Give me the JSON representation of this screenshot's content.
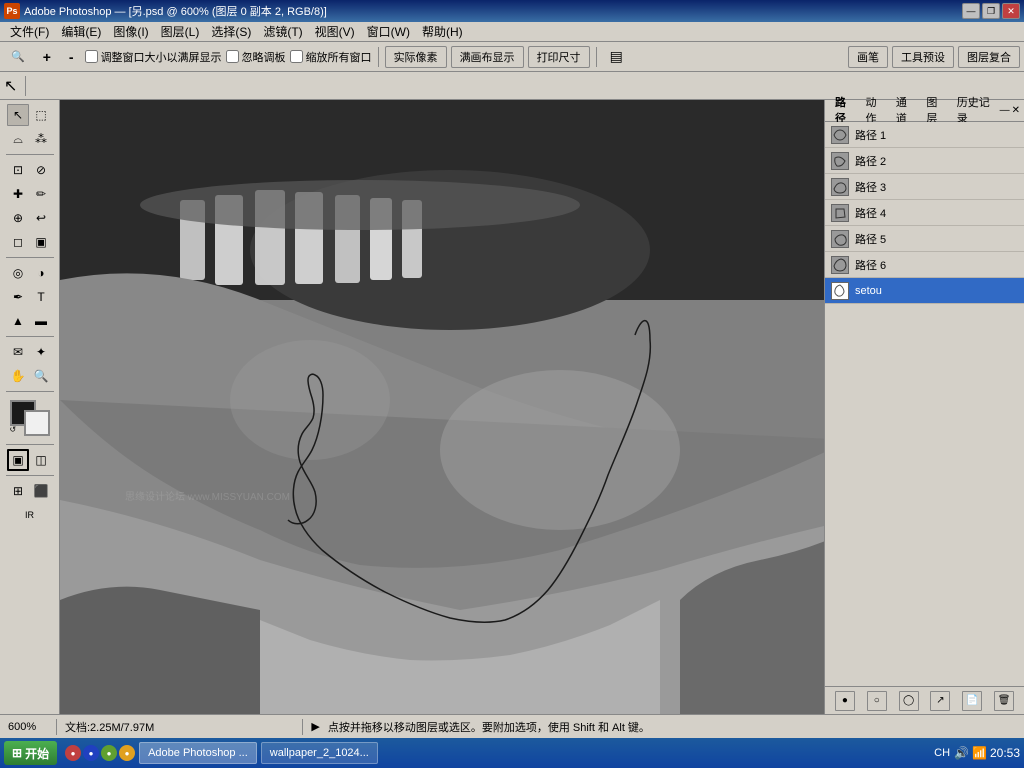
{
  "titlebar": {
    "title": "Adobe Photoshop — [另.psd @ 600% (图层 0 副本 2, RGB/8)]",
    "icon_label": "PS",
    "min_btn": "—",
    "restore_btn": "❐",
    "close_btn": "✕"
  },
  "menubar": {
    "items": [
      "文件(F)",
      "编辑(E)",
      "图像(I)",
      "图层(L)",
      "选择(S)",
      "滤镜(T)",
      "视图(V)",
      "窗口(W)",
      "帮助(H)"
    ]
  },
  "toolbar": {
    "zoom_in": "+",
    "zoom_out": "-",
    "fit_window_label": "调整窗口大小以满屏显示",
    "ignore_panel_label": "忽略调板",
    "shrink_all_label": "缩放所有窗口",
    "actual_pixels_label": "实际像素",
    "fill_screen_label": "满画布显示",
    "print_size_label": "打印尺寸"
  },
  "options_bar": {
    "tool_icon": "⊕"
  },
  "paths_panel": {
    "tabs": [
      "路径",
      "动作",
      "通道",
      "图层",
      "历史记录"
    ],
    "active_tab": "路径",
    "paths": [
      {
        "id": 1,
        "name": "路径 1",
        "thumb": "path"
      },
      {
        "id": 2,
        "name": "路径 2",
        "thumb": "path"
      },
      {
        "id": 3,
        "name": "路径 3",
        "thumb": "path"
      },
      {
        "id": 4,
        "name": "路径 4",
        "thumb": "path"
      },
      {
        "id": 5,
        "name": "路径 5",
        "thumb": "path"
      },
      {
        "id": 6,
        "name": "路径 6",
        "thumb": "path"
      },
      {
        "id": 7,
        "name": "setou",
        "thumb": "path",
        "selected": true
      }
    ],
    "bottom_buttons": [
      "●",
      "○",
      "◯",
      "↗",
      "🗑",
      "📄"
    ]
  },
  "panel_top_buttons": {
    "brush_label": "画笔",
    "tool_presets_label": "工具预设",
    "layer_comps_label": "图层复合"
  },
  "status_bar": {
    "zoom": "600%",
    "file_info": "文档:2.25M/7.97M",
    "tip": "点按并拖移以移动图层或选区。要附加选项，使用 Shift 和 Alt 键。"
  },
  "taskbar": {
    "start_label": "开始",
    "buttons": [
      "Adobe Photoshop ...",
      "wallpaper_2_1024..."
    ],
    "time": "20:53",
    "sys_area": "CH"
  }
}
